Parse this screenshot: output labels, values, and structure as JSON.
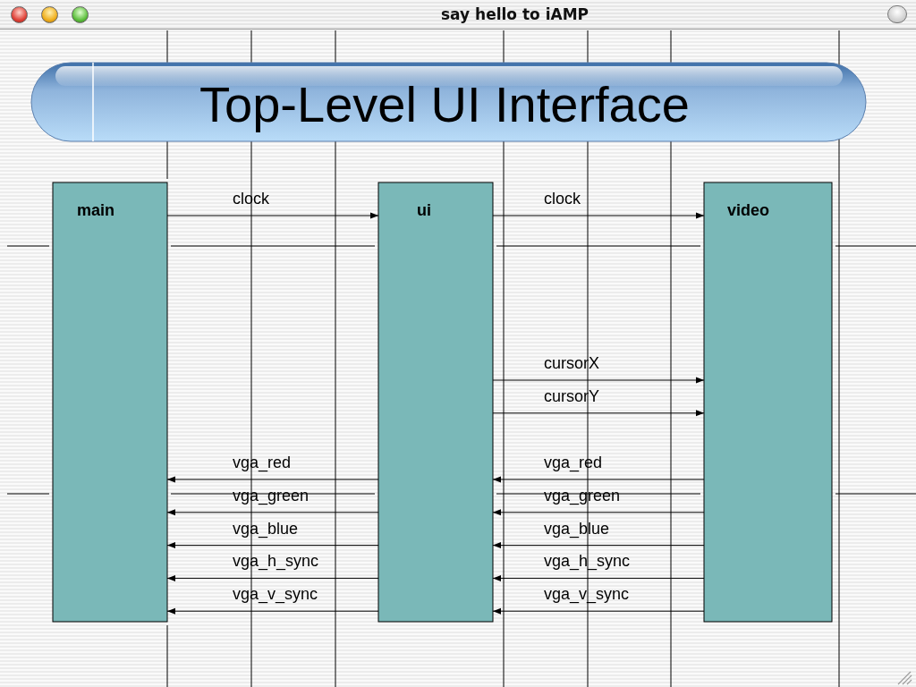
{
  "window": {
    "title": "say hello to iAMP"
  },
  "slide": {
    "title": "Top-Level UI Interface"
  },
  "blocks": [
    {
      "label": "main"
    },
    {
      "label": "ui"
    },
    {
      "label": "video"
    }
  ],
  "connections": [
    {
      "kind": "forward",
      "signals": [
        "clock"
      ]
    },
    {
      "kind": "forward",
      "signals": [
        "clock"
      ]
    },
    {
      "kind": "forward",
      "signals": [
        "cursorX",
        "cursorY"
      ]
    },
    {
      "kind": "return",
      "signals": [
        "vga_red",
        "vga_green",
        "vga_blue",
        "vga_h_sync",
        "vga_v_sync"
      ]
    },
    {
      "kind": "return",
      "signals": [
        "vga_red",
        "vga_green",
        "vga_blue",
        "vga_h_sync",
        "vga_v_sync"
      ]
    }
  ]
}
